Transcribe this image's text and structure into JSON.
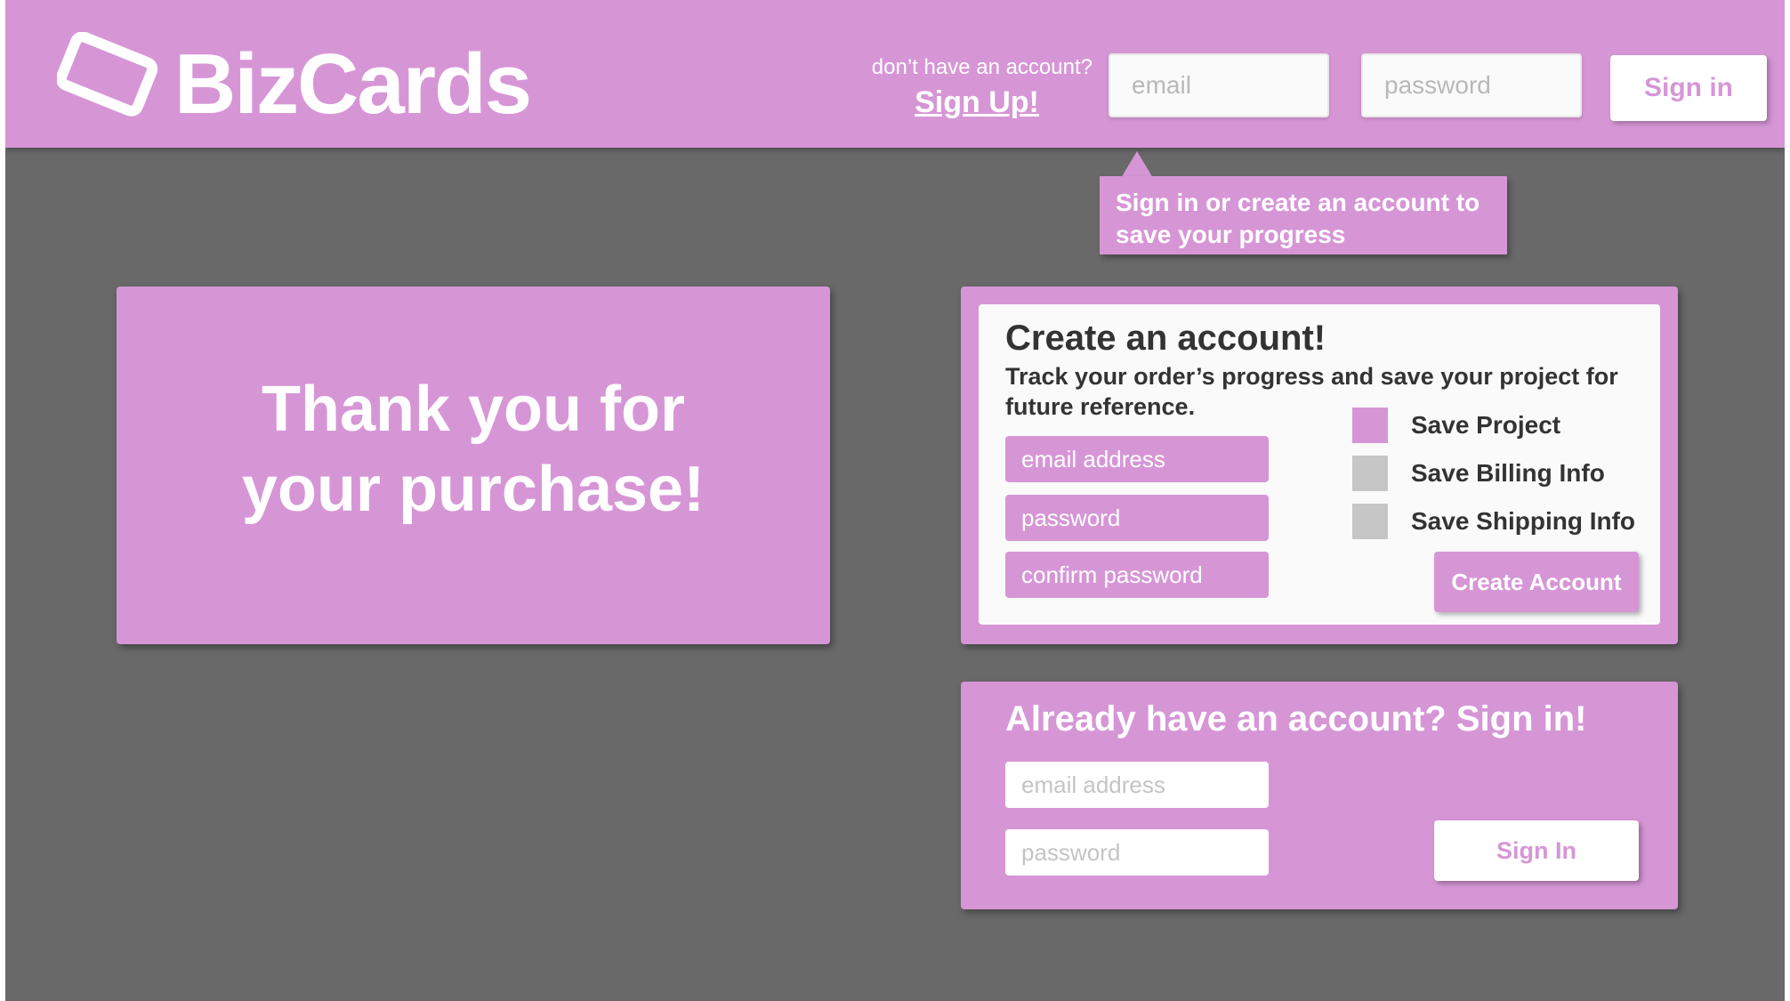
{
  "brand": {
    "name": "BizCards",
    "icon": "card-logo-icon",
    "accent_color": "#d696d6",
    "background_color": "#696969"
  },
  "header": {
    "no_account_text": "don’t have an account?",
    "signup_label": "Sign Up!",
    "email_placeholder": "email",
    "password_placeholder": "password",
    "signin_label": "Sign in"
  },
  "tooltip": {
    "text": "Sign in or create an account to save your progress"
  },
  "thanks": {
    "message": "Thank you for your purchase!"
  },
  "create_account": {
    "title": "Create an account!",
    "subtitle": "Track your order’s progress and save your project for future reference.",
    "email_placeholder": "email address",
    "password_placeholder": "password",
    "confirm_placeholder": "confirm password",
    "options": [
      {
        "label": "Save Project",
        "checked": true
      },
      {
        "label": "Save Billing Info",
        "checked": false
      },
      {
        "label": "Save Shipping Info",
        "checked": false
      }
    ],
    "button_label": "Create Account"
  },
  "sign_in": {
    "title": "Already have an account? Sign in!",
    "email_placeholder": "email address",
    "password_placeholder": "password",
    "button_label": "Sign In"
  }
}
